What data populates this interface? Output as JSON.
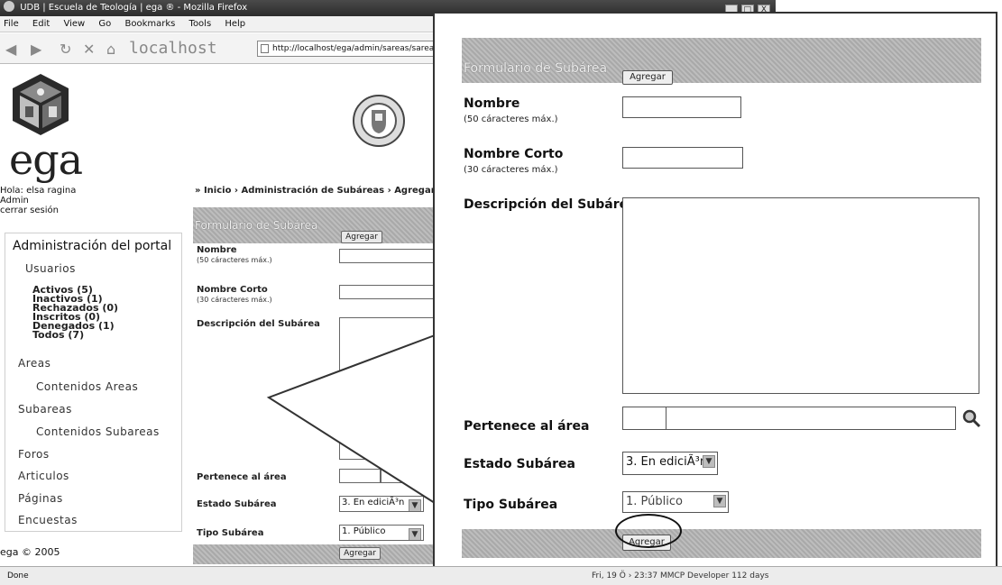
{
  "window": {
    "title": "UDB | Escuela de Teología | ega ® - Mozilla Firefox",
    "buttons": [
      "_",
      "□",
      "X"
    ]
  },
  "menu": [
    "File",
    "Edit",
    "View",
    "Go",
    "Bookmarks",
    "Tools",
    "Help"
  ],
  "toolbar": {
    "location_label": "localhost",
    "url": "http://localhost/ega/admin/sareas/sareas"
  },
  "page": {
    "logo_text": "ega",
    "greeting": "Hola: elsa ragina",
    "role": "Admin",
    "logout": "cerrar sesión",
    "breadcrumb": "» Inicio › Administración de Subáreas › Agregar",
    "copyright": "ega © 2005"
  },
  "sidebar": {
    "title": "Administración del portal",
    "usuarios": "Usuarios",
    "user_filters": [
      "Activos (5)",
      "Inactivos (1)",
      "Rechazados (0)",
      "Inscritos (0)",
      "Denegados (1)",
      "Todos (7)"
    ],
    "areas": "Areas",
    "contenidos_areas": "Contenidos Areas",
    "subareas": "Subareas",
    "contenidos_subareas": "Contenidos Subareas",
    "foros": "Foros",
    "articulos": "Articulos",
    "paginas": "Páginas",
    "encuestas": "Encuestas"
  },
  "form": {
    "header": "Formulario de Subárea",
    "add_button": "Agregar",
    "nombre_label": "Nombre",
    "nombre_note": "(50 cáracteres máx.)",
    "nombre_corto_label": "Nombre Corto",
    "nombre_corto_note": "(30 cáracteres máx.)",
    "descripcion_label": "Descripción del Subárea",
    "pertenece_label": "Pertenece al área",
    "estado_label": "Estado Subárea",
    "estado_value": "3. En ediciÃ³n",
    "tipo_label": "Tipo Subárea",
    "tipo_value": "1. Público"
  },
  "statusbar": {
    "done": "Done",
    "right": "Fri, 19 Ö › 23:37    MMCP Developer 112 days"
  }
}
